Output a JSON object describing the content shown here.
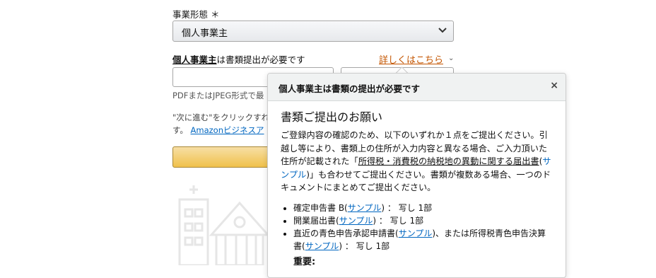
{
  "form": {
    "business_type_label": "事業形態 ＊",
    "business_type_value": "個人事業主",
    "requirement_bold": "個人事業主",
    "requirement_rest": "は書類提出が必要です",
    "details_link": "詳しくはこちら",
    "hint_visible": "PDFまたはJPEG形式で最",
    "next_line1": "\"次に進む\"をクリックすれ",
    "next_line2_prefix": "す。",
    "next_line2_link": "Amazonビジネスア"
  },
  "popover": {
    "title": "個人事業主は書類の提出が必要です",
    "close_symbol": "×",
    "heading": "書類ご提出のお願い",
    "para_1": "ご登録内容の確認のため、以下のいずれか１点をご提出ください。引越し等により、書類上の住所が入力内容と異なる場合、ご入力頂いた住所が記載された「",
    "para_link": "所得税・消費税の納税地の異動に関する届出書",
    "para_sample": "サンプル",
    "para_2": "」も合わせてご提出ください。書類が複数ある場合、一つのドキュメントにまとめてご提出ください。",
    "items": [
      {
        "prefix": "確定申告書 B(",
        "link": "サンプル",
        "suffix": ") ： 写し 1部"
      },
      {
        "prefix": "開業届出書(",
        "link": "サンプル",
        "suffix": ") ： 写し 1部"
      },
      {
        "prefix": "直近の青色申告承認申請書(",
        "link": "サンプル",
        "suffix": ")、または所得税青色申告決算書(",
        "link2": "サンプル",
        "suffix2": ") ： 写し 1部"
      }
    ],
    "important": "重要:"
  },
  "colors": {
    "link": "#0066c0",
    "details_link": "#c45500",
    "button": "#f0c14b"
  }
}
